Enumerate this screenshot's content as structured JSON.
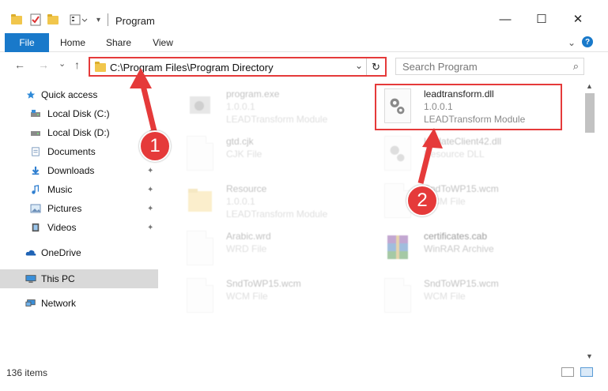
{
  "window": {
    "title": "Program",
    "minimize_glyph": "—",
    "maximize_glyph": "☐",
    "close_glyph": "✕"
  },
  "ribbon": {
    "tabs": [
      {
        "label": "File"
      },
      {
        "label": "Home"
      },
      {
        "label": "Share"
      },
      {
        "label": "View"
      }
    ],
    "expand_glyph": "⌄",
    "help_glyph": "?"
  },
  "nav": {
    "back_glyph": "←",
    "forward_glyph": "→",
    "recent_glyph": "⌄",
    "up_glyph": "↑",
    "address": "C:\\Program Files\\Program Directory",
    "dropdown_glyph": "⌄",
    "refresh_glyph": "↻",
    "search_placeholder": "Search Program",
    "search_glyph": "⌕"
  },
  "sidebar": {
    "items": [
      {
        "label": "Quick access",
        "icon": "star-icon",
        "pinned": false
      },
      {
        "label": "Local Disk (C:)",
        "icon": "drive-icon",
        "pinned": true
      },
      {
        "label": "Local Disk (D:)",
        "icon": "drive-icon",
        "pinned": true
      },
      {
        "label": "Documents",
        "icon": "documents-icon",
        "pinned": true
      },
      {
        "label": "Downloads",
        "icon": "download-icon",
        "pinned": true
      },
      {
        "label": "Music",
        "icon": "music-icon",
        "pinned": true
      },
      {
        "label": "Pictures",
        "icon": "pictures-icon",
        "pinned": true
      },
      {
        "label": "Videos",
        "icon": "videos-icon",
        "pinned": true
      },
      {
        "label": "OneDrive",
        "icon": "cloud-icon",
        "pinned": false
      },
      {
        "label": "This PC",
        "icon": "computer-icon",
        "pinned": false,
        "selected": true
      },
      {
        "label": "Network",
        "icon": "network-icon",
        "pinned": false
      }
    ],
    "pin_glyph": "📌"
  },
  "files": [
    {
      "name": "program.exe",
      "line2": "1.0.0.1",
      "line3": "LEADTransform Module",
      "faded": true
    },
    {
      "name": "leadtransform.dll",
      "line2": "1.0.0.1",
      "line3": "LEADTransform Module",
      "faded": false
    },
    {
      "name": "gtd.cjk",
      "line2": "CJK File",
      "line3": "",
      "faded": true
    },
    {
      "name": "UpdateClient42.dll",
      "line2": "Resource DLL",
      "line3": "",
      "faded": true
    },
    {
      "name": "Resource",
      "line2": "1.0.0.1",
      "line3": "LEADTransform Module",
      "faded": true
    },
    {
      "name": "SndToWP15.wcm",
      "line2": "WCM File",
      "line3": "",
      "faded": true
    },
    {
      "name": "Arabic.wrd",
      "line2": "WRD File",
      "line3": "",
      "faded": true
    },
    {
      "name": "certificates.cab",
      "line2": "WinRAR Archive",
      "line3": "",
      "faded": true
    },
    {
      "name": "SndToWP15.wcm",
      "line2": "WCM File",
      "line3": "",
      "faded": true
    },
    {
      "name": "SndToWP15.wcm",
      "line2": "WCM File",
      "line3": "",
      "faded": true
    }
  ],
  "status": {
    "item_count": "136 items"
  },
  "annotations": {
    "step1": "1",
    "step2": "2",
    "color": "#e53a3a"
  },
  "colors": {
    "accent": "#1979ca",
    "annotation": "#e53a3a",
    "selected_nav": "#d9d9d9"
  }
}
